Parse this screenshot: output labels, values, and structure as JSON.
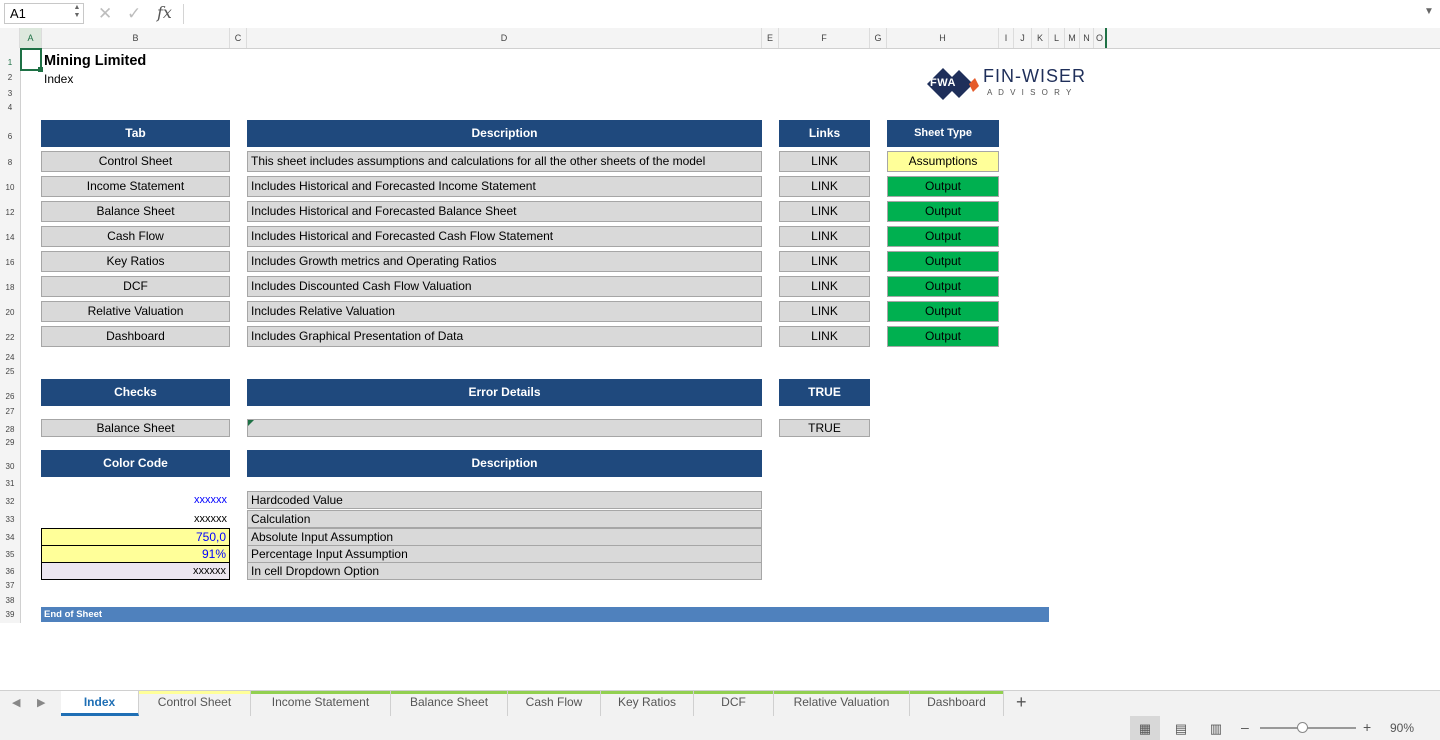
{
  "formula_bar": {
    "name_box": "A1",
    "fx": "fx",
    "formula": ""
  },
  "columns": [
    "A",
    "B",
    "C",
    "D",
    "E",
    "F",
    "G",
    "H",
    "I",
    "J",
    "K",
    "L",
    "M",
    "N",
    "O"
  ],
  "rows": [
    "1",
    "2",
    "3",
    "4",
    "6",
    "8",
    "10",
    "12",
    "14",
    "16",
    "18",
    "20",
    "22",
    "24",
    "25",
    "26",
    "27",
    "28",
    "29",
    "30",
    "31",
    "32",
    "33",
    "34",
    "35",
    "36",
    "37",
    "38",
    "39"
  ],
  "title": "Mining Limited",
  "subtitle": "Index",
  "logo": {
    "badge": "FWA",
    "name": "FIN-WISER",
    "tagline": "A D V I S O R Y"
  },
  "index_table": {
    "headers": {
      "tab": "Tab",
      "description": "Description",
      "links": "Links",
      "sheet_type": "Sheet Type"
    },
    "rows": [
      {
        "tab": "Control Sheet",
        "description": "This sheet includes assumptions and calculations for all the other sheets of the model",
        "link": "LINK",
        "type": "Assumptions"
      },
      {
        "tab": "Income Statement",
        "description": "Includes Historical and Forecasted Income Statement",
        "link": "LINK",
        "type": "Output"
      },
      {
        "tab": "Balance Sheet",
        "description": "Includes Historical and Forecasted Balance Sheet",
        "link": "LINK",
        "type": "Output"
      },
      {
        "tab": "Cash Flow",
        "description": "Includes Historical and Forecasted Cash Flow Statement",
        "link": "LINK",
        "type": "Output"
      },
      {
        "tab": "Key Ratios",
        "description": "Includes Growth metrics and Operating Ratios",
        "link": "LINK",
        "type": "Output"
      },
      {
        "tab": "DCF",
        "description": "Includes Discounted Cash Flow Valuation",
        "link": "LINK",
        "type": "Output"
      },
      {
        "tab": "Relative Valuation",
        "description": "Includes Relative Valuation",
        "link": "LINK",
        "type": "Output"
      },
      {
        "tab": "Dashboard",
        "description": "Includes Graphical Presentation of Data",
        "link": "LINK",
        "type": "Output"
      }
    ]
  },
  "checks": {
    "headers": {
      "checks": "Checks",
      "error_details": "Error Details",
      "status": "TRUE"
    },
    "row": {
      "name": "Balance Sheet",
      "details": "",
      "status": "TRUE"
    }
  },
  "color_code": {
    "headers": {
      "code": "Color Code",
      "description": "Description"
    },
    "rows": [
      {
        "sample": "xxxxxx",
        "description": "Hardcoded Value"
      },
      {
        "sample": "xxxxxx",
        "description": "Calculation"
      },
      {
        "sample": "750,0",
        "description": "Absolute Input Assumption"
      },
      {
        "sample": "91%",
        "description": "Percentage Input Assumption"
      },
      {
        "sample": "xxxxxx",
        "description": "In cell Dropdown Option"
      }
    ]
  },
  "end_of_sheet": "End of Sheet",
  "tabs": [
    {
      "label": "Index",
      "active": true,
      "color": "#ffffff"
    },
    {
      "label": "Control Sheet",
      "active": false,
      "color": "#ffff99"
    },
    {
      "label": "Income Statement",
      "active": false,
      "color": "#92d050"
    },
    {
      "label": "Balance Sheet",
      "active": false,
      "color": "#92d050"
    },
    {
      "label": "Cash Flow",
      "active": false,
      "color": "#92d050"
    },
    {
      "label": "Key Ratios",
      "active": false,
      "color": "#92d050"
    },
    {
      "label": "DCF",
      "active": false,
      "color": "#92d050"
    },
    {
      "label": "Relative Valuation",
      "active": false,
      "color": "#92d050"
    },
    {
      "label": "Dashboard",
      "active": false,
      "color": "#92d050"
    }
  ],
  "status_bar": {
    "zoom": "90%"
  },
  "colors": {
    "header_navy": "#1f497d",
    "output_green": "#00b050",
    "assumption_yellow": "#ffff99",
    "end_bar": "#4f81bd"
  }
}
